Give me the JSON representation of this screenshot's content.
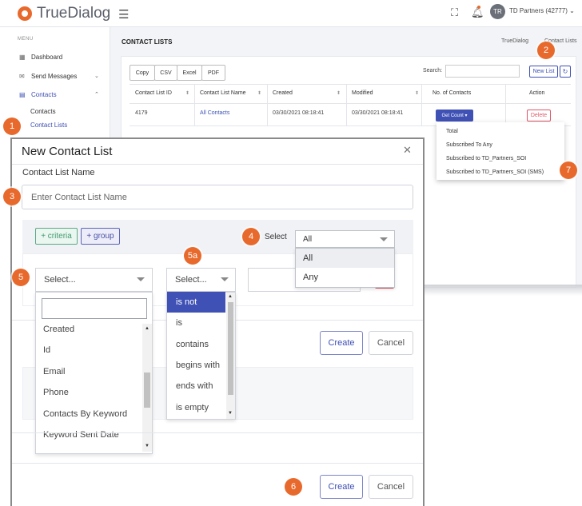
{
  "brand": {
    "name": "TrueDialog",
    "accent": "#e8692c",
    "primary": "#3f51b5",
    "danger": "#e05565"
  },
  "topbar": {
    "avatar_initials": "TR",
    "account": "TD Partners (42777)",
    "icons": [
      "hamburger-icon",
      "fullscreen-icon",
      "bell-icon",
      "chevron-down-icon"
    ]
  },
  "sidebar": {
    "menu_caption": "MENU",
    "items": [
      {
        "label": "Dashboard",
        "icon": "dashboard-icon"
      },
      {
        "label": "Send Messages",
        "icon": "send-icon"
      },
      {
        "label": "Contacts",
        "icon": "contacts-icon"
      }
    ],
    "subitems": [
      "Contacts",
      "Contact Lists"
    ]
  },
  "page": {
    "title": "CONTACT LISTS",
    "breadcrumb": [
      "TrueDialog",
      "Contact Lists"
    ]
  },
  "toolbar": {
    "export_buttons": [
      "Copy",
      "CSV",
      "Excel",
      "PDF"
    ],
    "search_label": "Search:",
    "search_value": "",
    "new_list": "New List"
  },
  "table": {
    "columns": [
      "Contact List ID",
      "Contact List Name",
      "Created",
      "Modified",
      "No. of Contacts",
      "Action"
    ],
    "rows": [
      {
        "id": "4179",
        "name": "All Contacts",
        "created": "03/30/2021 08:18:41",
        "modified": "03/30/2021 08:18:41",
        "count_button": "Get Count ▾",
        "action": "Delete"
      }
    ]
  },
  "count_menu": [
    "Total",
    "Subscribed To Any",
    "Subscribed to TD_Partners_SOI",
    "Subscribed to TD_Partners_SOI (SMS)"
  ],
  "modal": {
    "title": "New Contact List",
    "name_label": "Contact List Name",
    "name_placeholder": "Enter Contact List Name",
    "name_value": "",
    "add_criteria": "+ criteria",
    "add_group": "+ group",
    "select_label": "Select",
    "match_value": "All",
    "match_options": [
      "All",
      "Any"
    ],
    "match_highlighted": "All",
    "field_select": "Select...",
    "field_search_value": "",
    "field_options": [
      "Created",
      "Id",
      "Email",
      "Phone",
      "Contacts By Keyword",
      "Keyword Sent Date"
    ],
    "operator_select": "Select...",
    "operator_options": [
      "is not",
      "is",
      "contains",
      "begins with",
      "ends with",
      "is empty"
    ],
    "operator_selected": "is not",
    "create": "Create",
    "cancel": "Cancel"
  },
  "callouts": [
    "1",
    "2",
    "3",
    "4",
    "5",
    "5a",
    "6",
    "7"
  ]
}
